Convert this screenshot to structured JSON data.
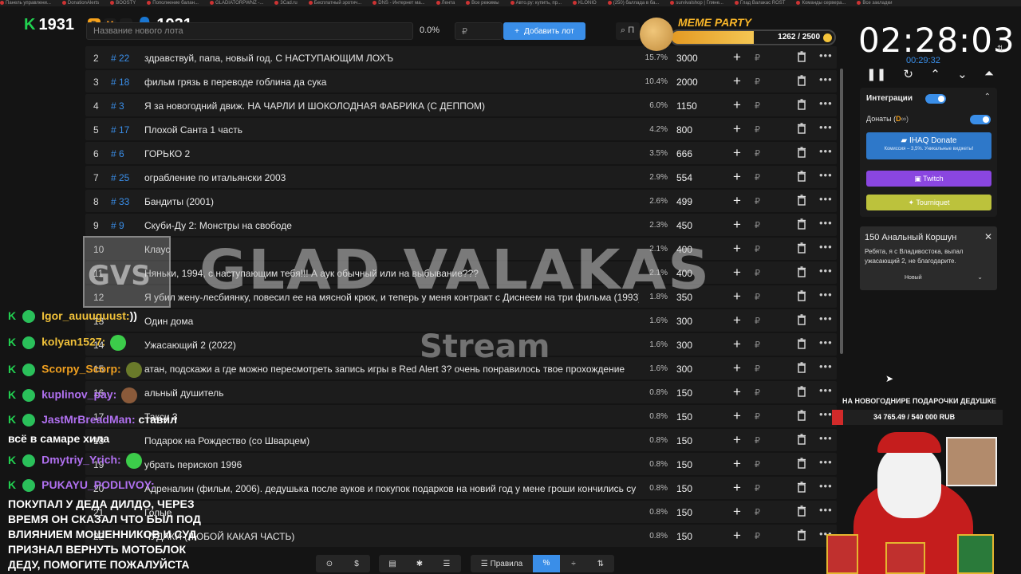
{
  "bookmarks": [
    "Панель управлени...",
    "DonationAlerts",
    "BOOSTY",
    "Пополнение балан...",
    "GLADIATORPWNZ -...",
    "3Cad.ru",
    "Бесплатный эротич...",
    "DNS - Интернет ма...",
    "Лента",
    "Все режимы",
    "Авто.ру: купить, пр...",
    "KLONIO",
    "(250) баллада в ба...",
    "survivalshop | Гляне...",
    "Глад Валакас ROST",
    "Команды сервера...",
    "Все закладки"
  ],
  "counters": {
    "left_value": "1931",
    "right_value": "1931"
  },
  "topbar": {
    "lot_placeholder": "Название нового лота",
    "percent": "0.0%",
    "price_placeholder": "₽",
    "add_label": "Добавить лот",
    "search_placeholder": "П"
  },
  "lots": [
    {
      "num": "2",
      "id": "# 22",
      "name": "здравствуй, папа, новый год. С НАСТУПАЮЩИМ ЛОХЪ",
      "pct": "15.7%",
      "amount": "3000"
    },
    {
      "num": "3",
      "id": "# 18",
      "name": "фильм грязь в переводе гоблина да сука",
      "pct": "10.4%",
      "amount": "2000"
    },
    {
      "num": "4",
      "id": "# 3",
      "name": "Я за новогодний движ. НА ЧАРЛИ И ШОКОЛОДНАЯ ФАБРИКА (С ДЕППОМ)",
      "pct": "6.0%",
      "amount": "1150"
    },
    {
      "num": "5",
      "id": "# 17",
      "name": "Плохой Санта 1 часть",
      "pct": "4.2%",
      "amount": "800"
    },
    {
      "num": "6",
      "id": "# 6",
      "name": "ГОРЬКО 2",
      "pct": "3.5%",
      "amount": "666"
    },
    {
      "num": "7",
      "id": "# 25",
      "name": "ограбление по итальянски 2003",
      "pct": "2.9%",
      "amount": "554"
    },
    {
      "num": "8",
      "id": "# 33",
      "name": "Бандиты (2001)",
      "pct": "2.6%",
      "amount": "499"
    },
    {
      "num": "9",
      "id": "# 9",
      "name": "Скуби-Ду 2: Монстры на свободе",
      "pct": "2.3%",
      "amount": "450"
    },
    {
      "num": "10",
      "id": "",
      "name": "Клаус",
      "pct": "2.1%",
      "amount": "400"
    },
    {
      "num": "11",
      "id": "",
      "name": "Няньки, 1994, с наступающим тебя!!! А аук обычный или на выбывание???",
      "pct": "2.1%",
      "amount": "400"
    },
    {
      "num": "12",
      "id": "",
      "name": "Я убил жену-лесбиянку, повесил ее на мясной крюк, и теперь у меня контракт с Диснеем на три фильма (1993)",
      "pct": "1.8%",
      "amount": "350"
    },
    {
      "num": "13",
      "id": "",
      "name": "Один дома",
      "pct": "1.6%",
      "amount": "300"
    },
    {
      "num": "14",
      "id": "",
      "name": "Ужасающий 2 (2022)",
      "pct": "1.6%",
      "amount": "300"
    },
    {
      "num": "15",
      "id": "",
      "name": "атан, подскажи а где можно пересмотреть запись игры в Red Alert 3? очень понравилось твое прохождение",
      "pct": "1.6%",
      "amount": "300"
    },
    {
      "num": "16",
      "id": "",
      "name": "альный душитель",
      "pct": "0.8%",
      "amount": "150"
    },
    {
      "num": "17",
      "id": "",
      "name": "Такси 3",
      "pct": "0.8%",
      "amount": "150"
    },
    {
      "num": "18",
      "id": "",
      "name": "Подарок на Рождество (со Шварцем)",
      "pct": "0.8%",
      "amount": "150"
    },
    {
      "num": "19",
      "id": "",
      "name": "убрать перископ 1996",
      "pct": "0.8%",
      "amount": "150"
    },
    {
      "num": "20",
      "id": "",
      "name": "Адреналин (фильм, 2006). дедушька после ауков и покупок подарков на новий год у мене гроши кончились су",
      "pct": "0.8%",
      "amount": "150"
    },
    {
      "num": "21",
      "id": "",
      "name": "Голые",
      "pct": "0.8%",
      "amount": "150"
    },
    {
      "num": "22",
      "id": "",
      "name": "ЧУДАКИ (ЛЮБОЙ КАКАЯ ЧАСТЬ)",
      "pct": "0.8%",
      "amount": "150"
    }
  ],
  "watermark": {
    "logo": "GVS",
    "title": "GLAD VALAKAS",
    "sub": "Stream"
  },
  "meme_party": {
    "title": "MEME PARTY",
    "count": "1262 / 2500",
    "progress": 0.5048
  },
  "timer": {
    "main": "02:28:03",
    "sub": "00:29:32"
  },
  "integrations": {
    "title": "Интеграции",
    "donations_label": "Донаты (",
    "donate_button": "IHAQ Donate",
    "donate_sub": "Комиссия – 3,5%. Уникальные виджеты!",
    "twitch": "Twitch",
    "tourniquet": "Tourniquet"
  },
  "donation_card": {
    "title": "150 Анальный Коршун",
    "message": "Ребята, я с Владивостока, выпал ужасающий 2, не благодарите.",
    "status": "Новый"
  },
  "goal": {
    "title": "НА НОВОГОДНИРЕ ПОДАРОЧКИ ДЕДУШКЕ",
    "text": "34 765.49 / 540 000 RUB",
    "progress": 0.0644
  },
  "chat": [
    {
      "user": "Igor_auuuguust:",
      "text": "))",
      "color": "#f0c13a"
    },
    {
      "user": "kolyan1527:",
      "text": "",
      "color": "#f0c13a"
    },
    {
      "user": "Scorpy_Scorp:",
      "text": "",
      "color": "#f0a020"
    },
    {
      "user": "kuplinov_pay:",
      "text": "",
      "color": "#b070f0"
    },
    {
      "user": "JastMrBreadMan:",
      "text": " ставил",
      "color": "#b070f0"
    },
    {
      "user": "Dmytriy_Yrich:",
      "text": "",
      "color": "#b070f0"
    },
    {
      "user": "PUKAYU_PODLIVOY:",
      "text": "",
      "color": "#b070f0"
    }
  ],
  "chat_lines": {
    "line1": "всё в самаре хила",
    "line2": "ПОКУПАЛ У ДЕДА ДИЛДО, ЧЕРЕЗ",
    "line3": "ВРЕМЯ ОН СКАЗАЛ ЧТО БЫЛ ПОД",
    "line4": "ВЛИЯНИЕМ МОШЕННИКОВ И СУД",
    "line5": "ПРИЗНАЛ ВЕРНУТЬ МОТОБЛОК",
    "line6": "ДЕДУ, ПОМОГИТЕ ПОЖАЛУЙСТА"
  },
  "bottombar": {
    "rules": "Правила"
  }
}
